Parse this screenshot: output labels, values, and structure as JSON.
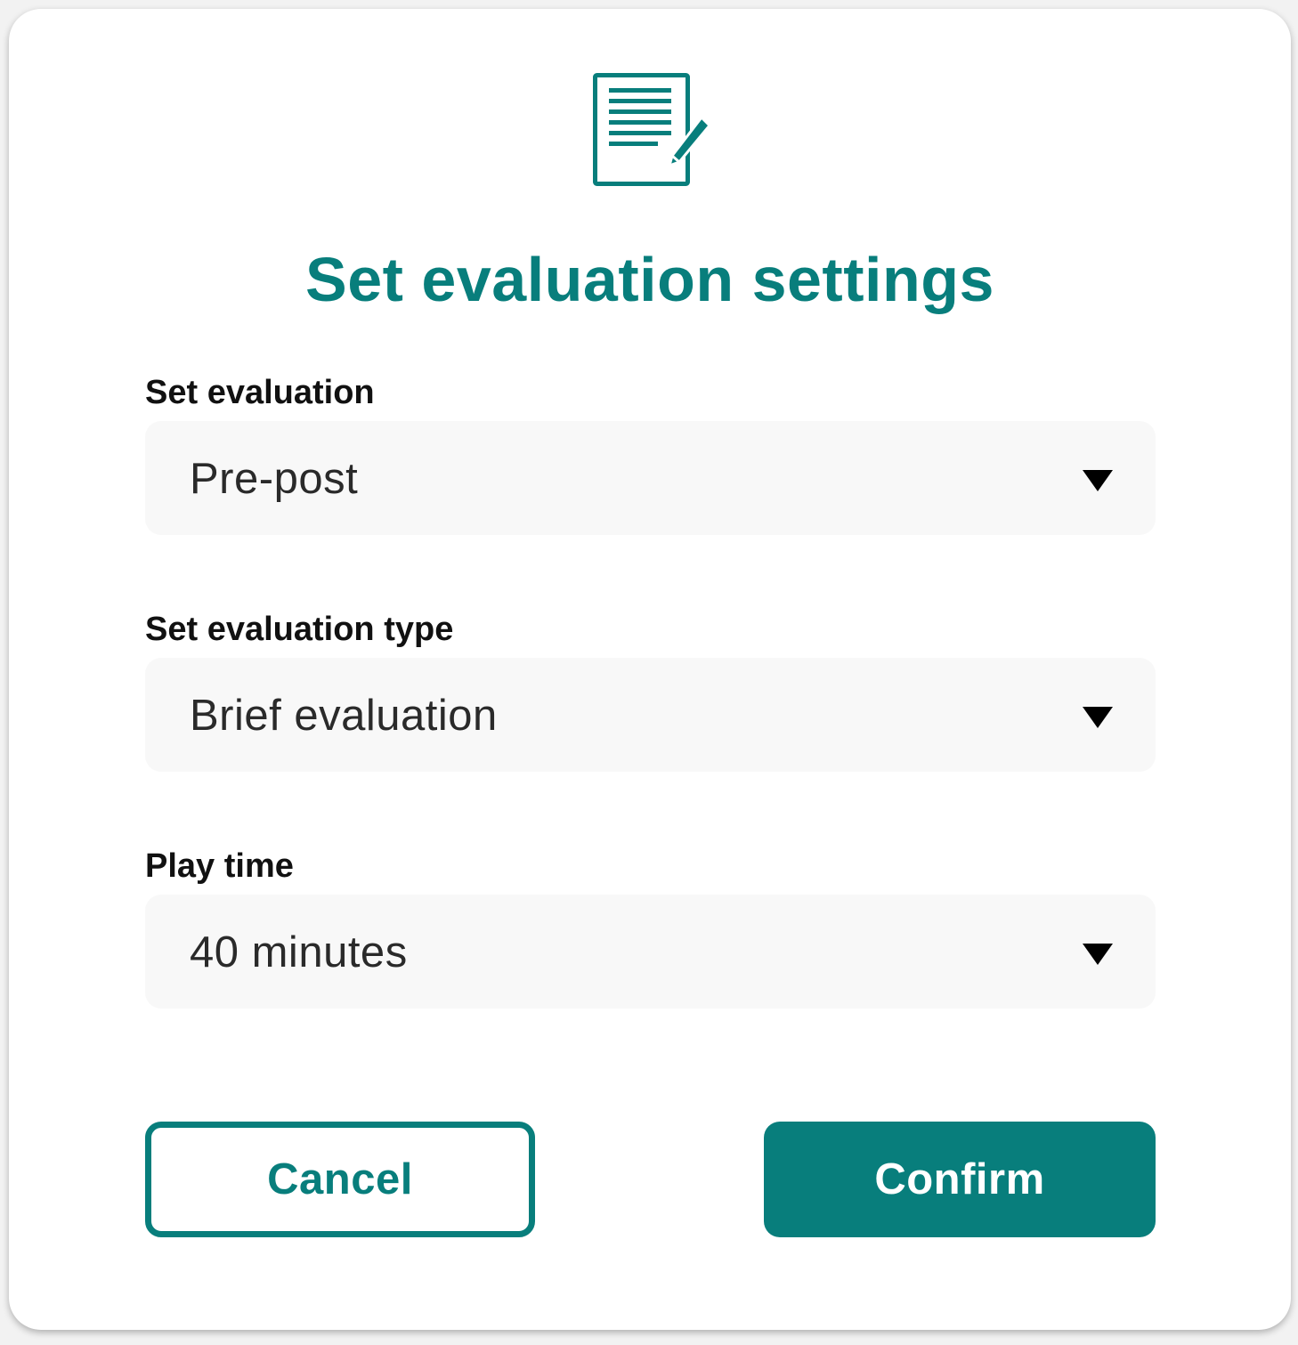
{
  "dialog": {
    "icon": "document-edit-icon",
    "title": "Set evaluation settings"
  },
  "fields": [
    {
      "label": "Set evaluation",
      "value": "Pre-post"
    },
    {
      "label": "Set evaluation type",
      "value": "Brief evaluation"
    },
    {
      "label": "Play time",
      "value": "40 minutes"
    }
  ],
  "actions": {
    "cancel_label": "Cancel",
    "confirm_label": "Confirm"
  },
  "colors": {
    "accent": "#087e7c",
    "field_background": "#f8f8f8",
    "text": "#111111"
  }
}
